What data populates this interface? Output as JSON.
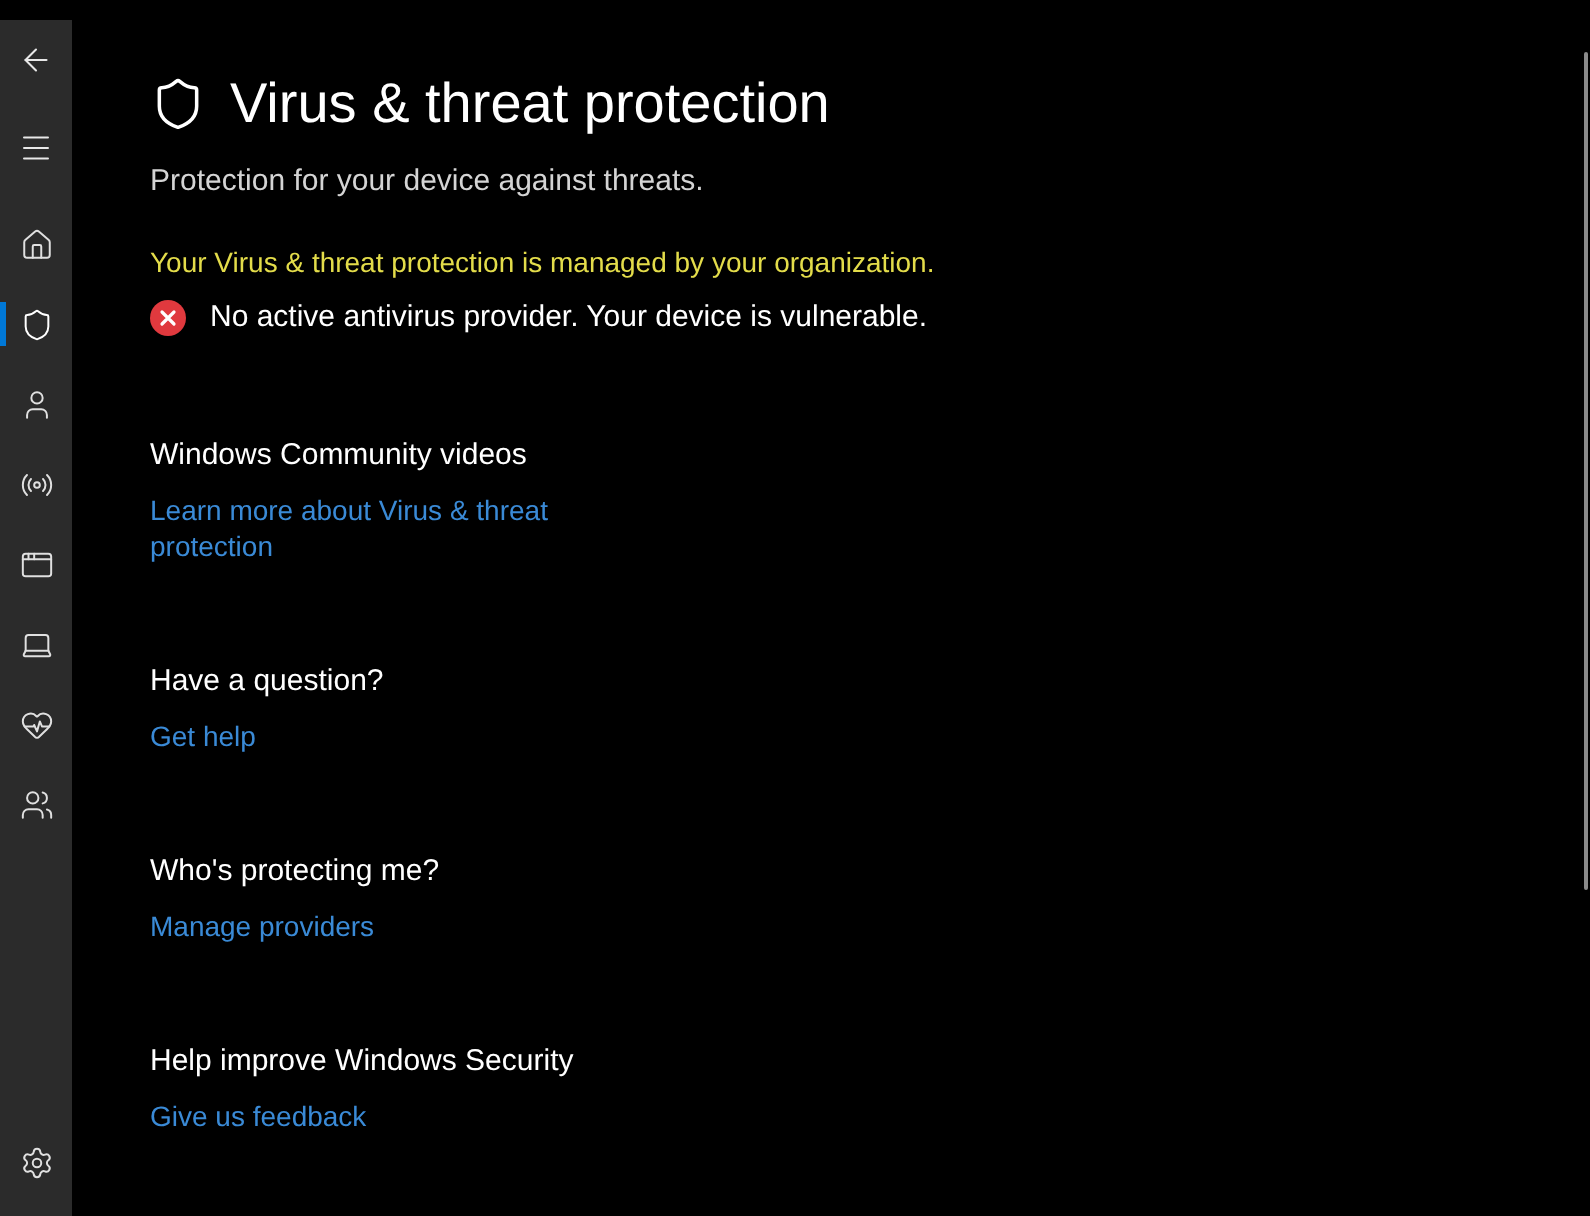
{
  "nav": {
    "items": [
      {
        "selected": false
      },
      {
        "selected": true
      },
      {
        "selected": false
      },
      {
        "selected": false
      },
      {
        "selected": false
      },
      {
        "selected": false
      },
      {
        "selected": false
      },
      {
        "selected": false
      }
    ]
  },
  "page": {
    "title": "Virus & threat protection",
    "subtitle": "Protection for your device against threats.",
    "notice": "Your Virus & threat protection is managed by your organization.",
    "status": {
      "kind": "error",
      "text": "No active antivirus provider. Your device is vulnerable."
    }
  },
  "sections": [
    {
      "heading": "Windows Community videos",
      "link": "Learn more about Virus & threat protection"
    },
    {
      "heading": "Have a question?",
      "link": "Get help"
    },
    {
      "heading": "Who's protecting me?",
      "link": "Manage providers"
    },
    {
      "heading": "Help improve Windows Security",
      "link": "Give us feedback"
    }
  ]
}
